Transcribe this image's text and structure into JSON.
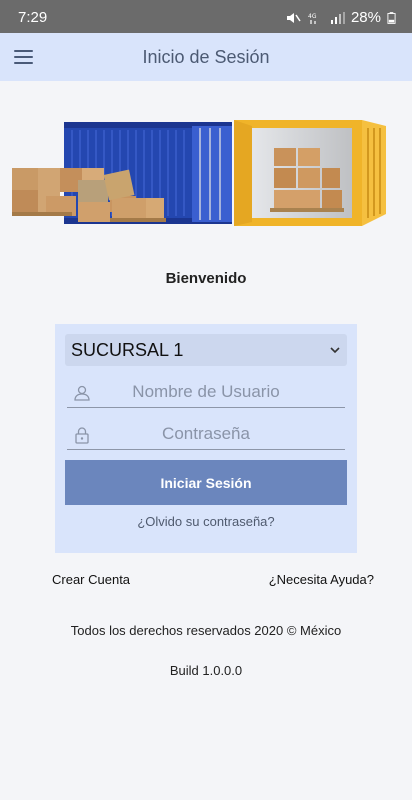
{
  "status_bar": {
    "time": "7:29",
    "battery": "28%"
  },
  "app_bar": {
    "title": "Inicio de Sesión",
    "menu_icon": "hamburger-menu-icon"
  },
  "hero": {
    "image": "shipping-containers-with-boxes"
  },
  "welcome_text": "Bienvenido",
  "login_form": {
    "branch": {
      "selected": "SUCURSAL 1"
    },
    "username": {
      "placeholder": "Nombre de Usuario",
      "icon": "user-icon"
    },
    "password": {
      "placeholder": "Contraseña",
      "icon": "lock-icon"
    },
    "submit_label": "Iniciar Sesión",
    "forgot_label": "¿Olvido su contraseña?"
  },
  "links": {
    "create_account": "Crear Cuenta",
    "help": "¿Necesita Ayuda?"
  },
  "footer": {
    "rights": "Todos los derechos reservados 2020 © México",
    "build": "Build 1.0.0.0"
  },
  "colors": {
    "app_bar": "#d9e4fb",
    "card": "#d9e4fb",
    "button": "#6b86bd",
    "background": "#f4f5f8"
  }
}
